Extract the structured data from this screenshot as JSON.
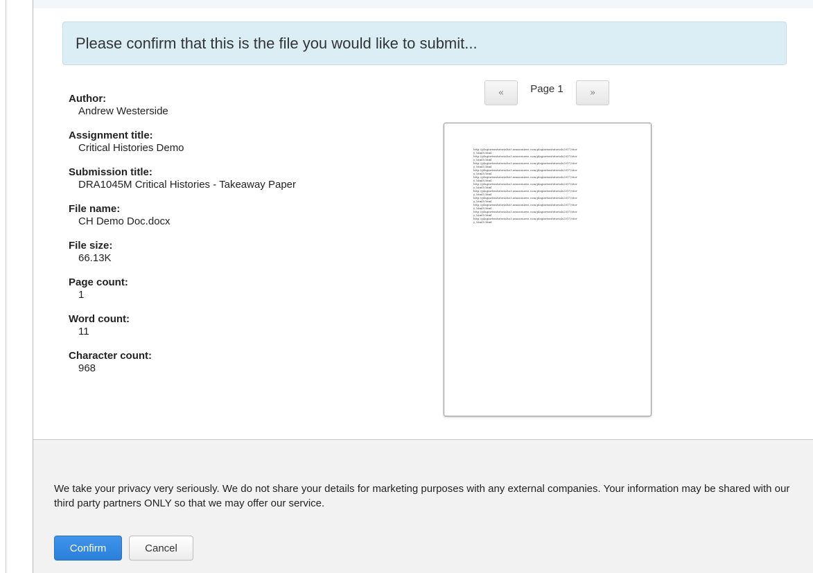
{
  "banner": {
    "text": "Please confirm that this is the file you would like to submit..."
  },
  "details": [
    {
      "label": "Author:",
      "value": "Andrew Westerside"
    },
    {
      "label": "Assignment title:",
      "value": "Critical Histories Demo"
    },
    {
      "label": "Submission title:",
      "value": "DRA1045M Critical Histories - Takeaway Paper"
    },
    {
      "label": "File name:",
      "value": "CH Demo Doc.docx"
    },
    {
      "label": "File size:",
      "value": "66.13K"
    },
    {
      "label": "Page count:",
      "value": "1"
    },
    {
      "label": "Word count:",
      "value": "11"
    },
    {
      "label": "Character count:",
      "value": "968"
    }
  ],
  "pager": {
    "prev": "«",
    "label": "Page 1",
    "next": "»"
  },
  "preview": {
    "lines": [
      "http://plagiarismtutorialsz3.amazonaws.com/plagiarismtutorials2017/stor",
      "y_html5.html",
      "http://plagiarismtutorialsz3.amazonaws.com/plagiarismtutorials2017/stor",
      "y_html5.html",
      "http://plagiarismtutorialsz3.amazonaws.com/plagiarismtutorials2017/stor",
      "y_html5.html",
      "http://plagiarismtutorialsz3.amazonaws.com/plagiarismtutorials2017/stor",
      "y_html5.html",
      "http://plagiarismtutorialsz3.amazonaws.com/plagiarismtutorials2017/stor",
      "y_html5.html",
      "http://plagiarismtutorialsz3.amazonaws.com/plagiarismtutorials2017/stor",
      "y_html5.html",
      "http://plagiarismtutorialsz3.amazonaws.com/plagiarismtutorials2017/stor",
      "y_html5.html",
      "http://plagiarismtutorialsz3.amazonaws.com/plagiarismtutorials2017/stor",
      "y_html5.html",
      "http://plagiarismtutorialsz3.amazonaws.com/plagiarismtutorials2017/stor",
      "y_html5.html",
      "http://plagiarismtutorialsz3.amazonaws.com/plagiarismtutorials2017/stor",
      "y_html5.html",
      "http://plagiarismtutorialsz3.amazonaws.com/plagiarismtutorials2017/stor",
      "y_html5.html"
    ]
  },
  "footer": {
    "privacy_text": "We take your privacy very seriously. We do not share your details for marketing purposes with any external companies. Your information may be shared with our third party partners ONLY so that we may offer our service.",
    "confirm_label": "Confirm",
    "cancel_label": "Cancel"
  },
  "colors": {
    "banner_bg": "#dbeef5",
    "confirm_button": "#2f88e0",
    "footer_bg": "#f2f2f2"
  }
}
